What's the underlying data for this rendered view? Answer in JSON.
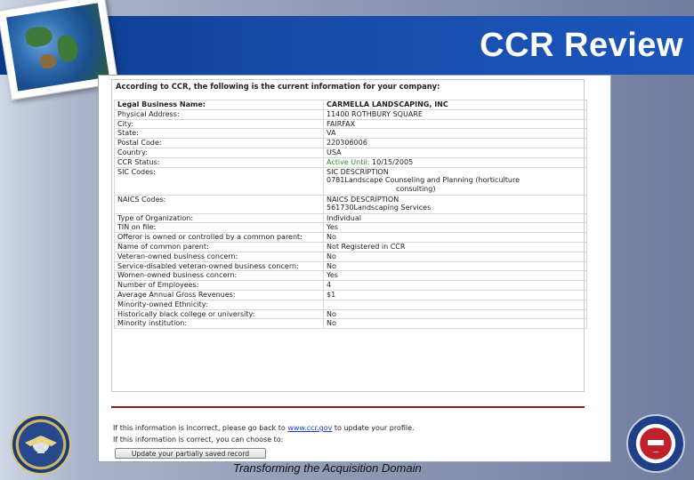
{
  "slide": {
    "title": "CCR Review",
    "footer": "Transforming the Acquisition Domain"
  },
  "screen": {
    "intro": "According to CCR, the following is the current information for your company:",
    "rows": [
      {
        "label": "Legal Business Name:",
        "value": "CARMELLA LANDSCAPING, INC"
      },
      {
        "label": "Physical Address:",
        "value": "11400 ROTHBURY SQUARE"
      },
      {
        "label": "City:",
        "value": "FAIRFAX"
      },
      {
        "label": "State:",
        "value": "VA"
      },
      {
        "label": "Postal Code:",
        "value": "220306006"
      },
      {
        "label": "Country:",
        "value": "USA"
      },
      {
        "label": "CCR Status:",
        "value_status": "Active Until:",
        "value_date": "10/15/2005"
      },
      {
        "label": "SIC Codes:",
        "value_header": "SIC  DESCRIPTION",
        "value_line1": "0781Landscape Counseling and Planning (horticulture",
        "value_line2": "consulting)"
      },
      {
        "label": "NAICS Codes:",
        "value_header": "NAICS  DESCRIPTION",
        "value_line1": "561730Landscaping Services"
      },
      {
        "label": "Type of Organization:",
        "value": "Individual"
      },
      {
        "label": "TIN on file:",
        "value": "Yes"
      },
      {
        "label": "Offeror is owned or controlled by a common parent:",
        "value": "No"
      },
      {
        "label": "Name of common parent:",
        "value": "Not Registered in CCR"
      },
      {
        "label": "Veteran-owned business concern:",
        "value": "No"
      },
      {
        "label": "Service-disabled veteran-owned business concern:",
        "value": "No"
      },
      {
        "label": "Women-owned business concern:",
        "value": "Yes"
      },
      {
        "label": "Number of Employees:",
        "value": "4"
      },
      {
        "label": "Average Annual Gross Revenues:",
        "value": "$1"
      },
      {
        "label": "Minority-owned Ethnicity:",
        "value": ""
      },
      {
        "label": "Historically black college or university:",
        "value": "No"
      },
      {
        "label": "Minority institution:",
        "value": "No"
      }
    ],
    "incorrect_pre": "If this information is incorrect, please go back to ",
    "incorrect_link": "www.ccr.gov",
    "incorrect_post": " to update your profile.",
    "correct_text": "If this information is correct, you can choose to:",
    "update_button": "Update your partially saved record"
  },
  "icons": {
    "left_seal": "department-of-defense-seal-icon",
    "right_seal": "dod-program-seal-icon",
    "globe": "globe-photo-icon"
  }
}
